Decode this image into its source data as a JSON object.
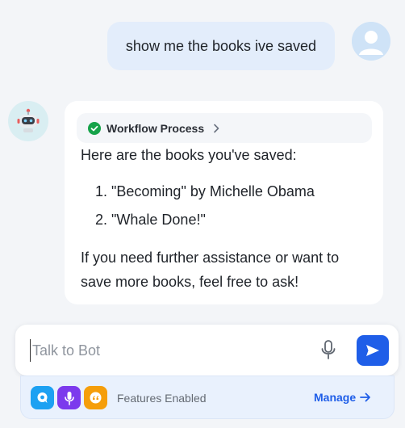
{
  "conversation": {
    "user_message": "show me the books ive saved",
    "bot": {
      "workflow_label": "Workflow Process",
      "intro": "Here are the books you've saved:",
      "books": [
        "1. \"Becoming\" by Michelle Obama",
        "2. \"Whale Done!\""
      ],
      "outro": "If you need further assistance or want to save more books, feel free to ask!"
    }
  },
  "composer": {
    "placeholder": "Talk to Bot",
    "value": ""
  },
  "features": {
    "label": "Features Enabled",
    "manage_label": "Manage",
    "icons": [
      "chat-icon",
      "microphone-icon",
      "quote-icon"
    ]
  },
  "colors": {
    "accent": "#1f5ee8",
    "user_bubble": "#e3edfb",
    "success": "#16a34a"
  }
}
